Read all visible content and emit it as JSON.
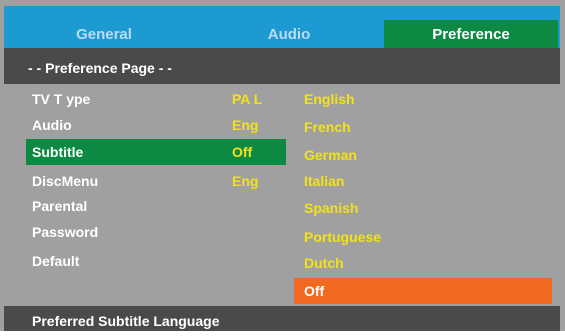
{
  "tabs": {
    "general": "General",
    "audio": "Audio",
    "preference": "Preference"
  },
  "page_title": "- -  Preference Page - -",
  "settings": [
    {
      "label": "TV T  ype",
      "value": "PA L"
    },
    {
      "label": "Audio",
      "value": "Eng"
    },
    {
      "label": "Subtitle",
      "value": "Off"
    },
    {
      "label": "DiscMenu",
      "value": "Eng"
    },
    {
      "label": "Parental",
      "value": ""
    },
    {
      "label": "Password",
      "value": ""
    },
    {
      "label": "Default",
      "value": ""
    }
  ],
  "options": [
    "English",
    "French",
    "German",
    "Italian",
    "Spanish",
    "Portuguese",
    "Dutch",
    "Off"
  ],
  "footer": "Preferred Subtitle Language",
  "colors": {
    "tab_bar": "#1e9ad2",
    "selected": "#0c8a43",
    "value": "#f2e21a",
    "option_highlight": "#f26a22",
    "panel": "#a0a0a0",
    "header_bar": "#4a4a4a"
  }
}
